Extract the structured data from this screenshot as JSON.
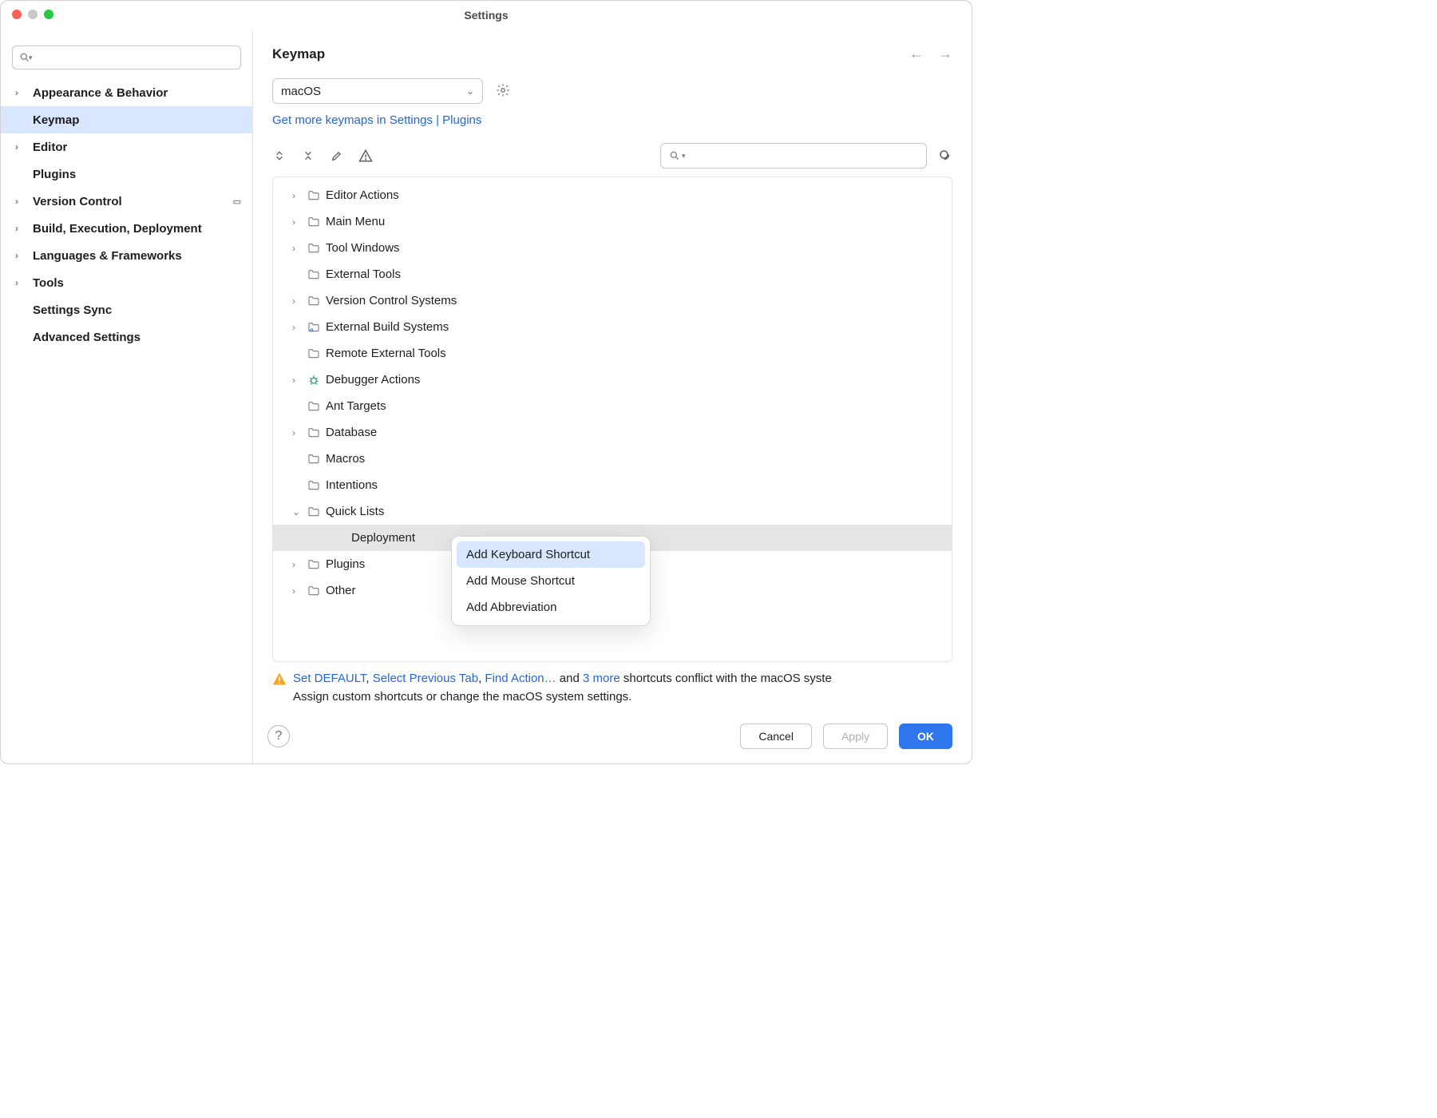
{
  "window": {
    "title": "Settings"
  },
  "sidebar": {
    "items": [
      {
        "label": "Appearance & Behavior",
        "expandable": true
      },
      {
        "label": "Keymap",
        "expandable": false,
        "selected": true
      },
      {
        "label": "Editor",
        "expandable": true
      },
      {
        "label": "Plugins",
        "expandable": false
      },
      {
        "label": "Version Control",
        "expandable": true,
        "badge": true
      },
      {
        "label": "Build, Execution, Deployment",
        "expandable": true
      },
      {
        "label": "Languages & Frameworks",
        "expandable": true
      },
      {
        "label": "Tools",
        "expandable": true
      },
      {
        "label": "Settings Sync",
        "expandable": false
      },
      {
        "label": "Advanced Settings",
        "expandable": false
      }
    ]
  },
  "main": {
    "heading": "Keymap",
    "scheme": "macOS",
    "plugins_link": {
      "a": "Get more keymaps in Settings",
      "sep": "|",
      "b": "Plugins"
    },
    "action_tree": [
      {
        "label": "Editor Actions",
        "icon": "folder",
        "expandable": true
      },
      {
        "label": "Main Menu",
        "icon": "folder",
        "expandable": true
      },
      {
        "label": "Tool Windows",
        "icon": "folder",
        "expandable": true
      },
      {
        "label": "External Tools",
        "icon": "folder",
        "expandable": false
      },
      {
        "label": "Version Control Systems",
        "icon": "folder",
        "expandable": true
      },
      {
        "label": "External Build Systems",
        "icon": "folder-gear",
        "expandable": true
      },
      {
        "label": "Remote External Tools",
        "icon": "folder",
        "expandable": false
      },
      {
        "label": "Debugger Actions",
        "icon": "bug",
        "expandable": true
      },
      {
        "label": "Ant Targets",
        "icon": "folder",
        "expandable": false
      },
      {
        "label": "Database",
        "icon": "folder",
        "expandable": true
      },
      {
        "label": "Macros",
        "icon": "folder",
        "expandable": false
      },
      {
        "label": "Intentions",
        "icon": "folder",
        "expandable": false
      },
      {
        "label": "Quick Lists",
        "icon": "folder",
        "expandable": true,
        "expanded": true
      },
      {
        "label": "Deployment",
        "icon": "",
        "expandable": false,
        "level": 2,
        "selected": true
      },
      {
        "label": "Plugins",
        "icon": "folder",
        "expandable": true
      },
      {
        "label": "Other",
        "icon": "folder",
        "expandable": true
      }
    ],
    "context_menu": [
      {
        "label": "Add Keyboard Shortcut",
        "highlight": true
      },
      {
        "label": "Add Mouse Shortcut"
      },
      {
        "label": "Add Abbreviation"
      }
    ],
    "warning": {
      "a": "Set DEFAULT",
      "c1": ", ",
      "b": "Select Previous Tab",
      "c2": ", ",
      "c": "Find Action…",
      "mid": " and ",
      "d": "3 more",
      "tail1": " shortcuts conflict with the macOS syste",
      "tail2": "Assign custom shortcuts or change the macOS system settings."
    }
  },
  "footer": {
    "cancel": "Cancel",
    "apply": "Apply",
    "ok": "OK"
  }
}
